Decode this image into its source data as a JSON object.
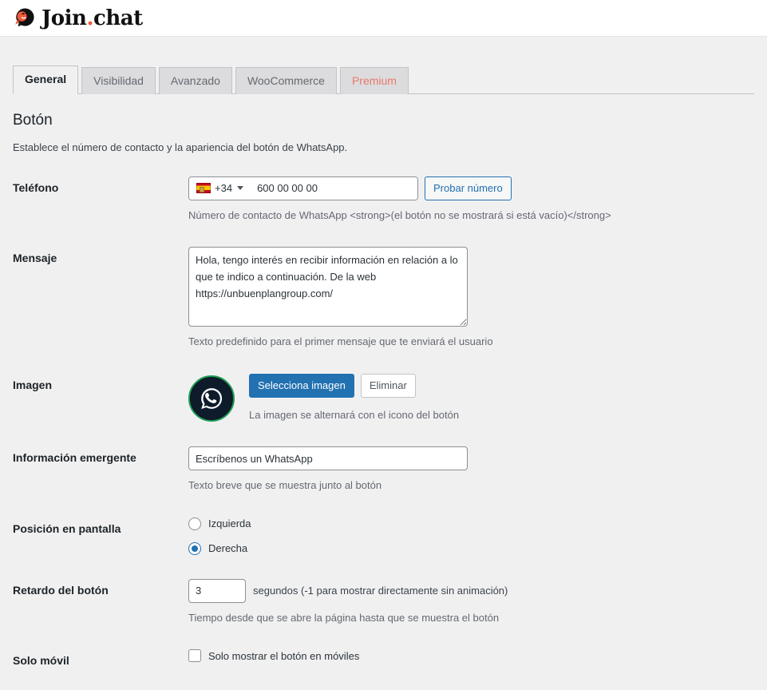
{
  "header": {
    "logo_name": "join-chat-logo",
    "brand_first": "Join",
    "brand_dot": ".",
    "brand_second": "chat"
  },
  "tabs": [
    {
      "label": "General",
      "state": "active"
    },
    {
      "label": "Visibilidad",
      "state": "inactive"
    },
    {
      "label": "Avanzado",
      "state": "inactive"
    },
    {
      "label": "WooCommerce",
      "state": "inactive"
    },
    {
      "label": "Premium",
      "state": "premium"
    }
  ],
  "section": {
    "title": "Botón",
    "description": "Establece el número de contacto y la apariencia del botón de WhatsApp."
  },
  "fields": {
    "phone": {
      "label": "Teléfono",
      "country_dial_code": "+34",
      "country_flag": "spain-flag-icon",
      "value": "",
      "placeholder": "600 00 00 00",
      "test_button": "Probar número",
      "help": "Número de contacto de WhatsApp <strong>(el botón no se mostrará si está vacío)</strong>"
    },
    "message": {
      "label": "Mensaje",
      "value": "Hola, tengo interés en recibir información en relación a lo que te indico a continuación. De la web https://unbuenplangroup.com/",
      "help": "Texto predefinido para el primer mensaje que te enviará el usuario"
    },
    "image": {
      "label": "Imagen",
      "thumb_icon": "whatsapp-icon",
      "select_button": "Selecciona imagen",
      "remove_button": "Eliminar",
      "help": "La imagen se alternará con el icono del botón"
    },
    "tooltip": {
      "label": "Información emergente",
      "value": "Escríbenos un WhatsApp",
      "help": "Texto breve que se muestra junto al botón"
    },
    "position": {
      "label": "Posición en pantalla",
      "options": [
        {
          "label": "Izquierda",
          "selected": false
        },
        {
          "label": "Derecha",
          "selected": true
        }
      ]
    },
    "delay": {
      "label": "Retardo del botón",
      "value": "3",
      "suffix": "segundos (-1 para mostrar directamente sin animación)",
      "help": "Tiempo desde que se abre la página hasta que se muestra el botón"
    },
    "mobile_only": {
      "label": "Solo móvil",
      "checkbox_label": "Solo mostrar el botón en móviles",
      "checked": false
    }
  },
  "colors": {
    "accent_blue": "#2271b1",
    "premium_red": "#e8796e",
    "brand_orange": "#ef5b3a",
    "whatsapp_green": "#1f9d55",
    "page_bg": "#f0f0f1"
  }
}
